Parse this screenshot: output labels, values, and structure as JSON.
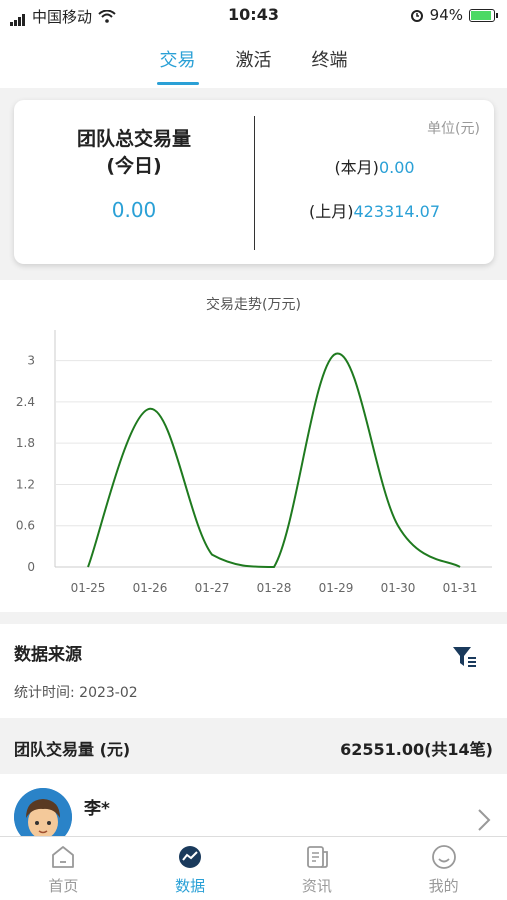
{
  "status_bar": {
    "carrier": "中国移动",
    "time": "10:43",
    "battery": "94%",
    "icons": [
      "signal-icon",
      "wifi-icon",
      "alarm-icon",
      "battery-icon"
    ]
  },
  "top_tabs": [
    {
      "label": "交易",
      "active": true
    },
    {
      "label": "激活",
      "active": false
    },
    {
      "label": "终端",
      "active": false
    }
  ],
  "summary": {
    "title_line1": "团队总交易量",
    "title_line2": "(今日)",
    "today_value": "0.00",
    "unit": "单位(元)",
    "this_month_label": "(本月)",
    "this_month_value": "0.00",
    "last_month_label": "(上月)",
    "last_month_value": "423314.07"
  },
  "chart_data": {
    "type": "line",
    "title": "交易走势(万元)",
    "x": [
      "01-25",
      "01-26",
      "01-27",
      "01-28",
      "01-29",
      "01-30",
      "01-31"
    ],
    "series": [
      {
        "values": [
          0,
          2.3,
          0.18,
          0,
          3.1,
          0.6,
          0
        ]
      }
    ],
    "ylim": [
      0,
      3.3
    ],
    "yticks": [
      "0",
      "0.6",
      "1.2",
      "1.8",
      "2.4",
      "3"
    ],
    "grid": true,
    "line_color": "#1f7a1f"
  },
  "source": {
    "title": "数据来源",
    "stat_time": "统计时间: 2023-02",
    "filter_icon": "filter-icon"
  },
  "team_volume": {
    "label": "团队交易量 (元)",
    "value": "62551.00(共14笔)"
  },
  "members": [
    {
      "name": "李*"
    }
  ],
  "bottom_nav": [
    {
      "label": "首页",
      "icon": "home-icon",
      "active": false
    },
    {
      "label": "数据",
      "icon": "chart-icon",
      "active": true
    },
    {
      "label": "资讯",
      "icon": "news-icon",
      "active": false
    },
    {
      "label": "我的",
      "icon": "profile-icon",
      "active": false
    }
  ],
  "colors": {
    "accent": "#2aa0d6",
    "line": "#1f7a1f"
  }
}
